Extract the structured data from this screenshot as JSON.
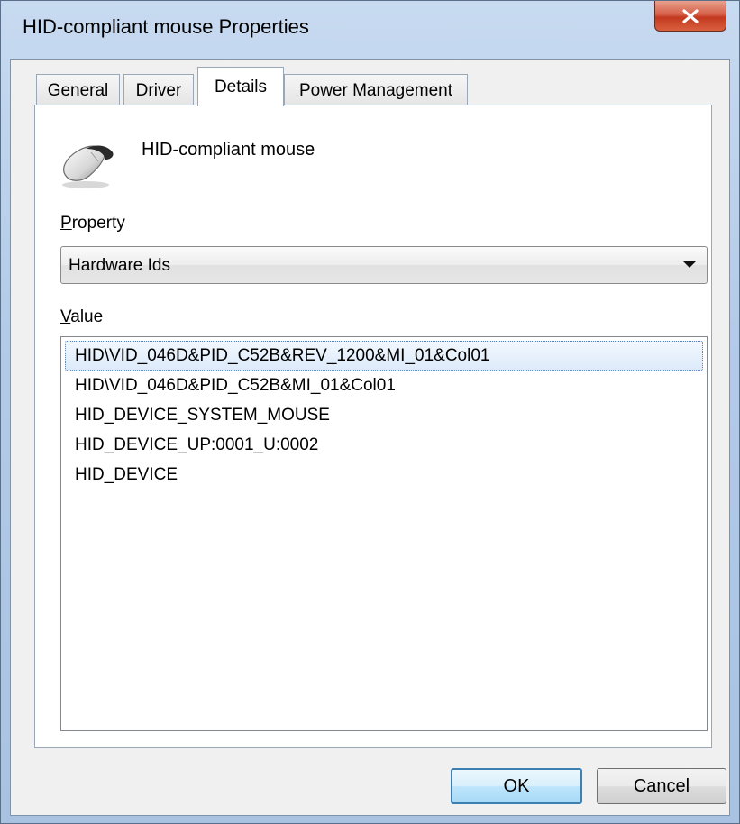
{
  "window": {
    "title": "HID-compliant mouse Properties"
  },
  "tabs": [
    {
      "label": "General",
      "active": false
    },
    {
      "label": "Driver",
      "active": false
    },
    {
      "label": "Details",
      "active": true
    },
    {
      "label": "Power Management",
      "active": false
    }
  ],
  "device": {
    "name": "HID-compliant mouse",
    "icon": "mouse-icon"
  },
  "property": {
    "label_mnemonic": "P",
    "label_rest": "roperty",
    "selected": "Hardware Ids"
  },
  "value": {
    "label_mnemonic": "V",
    "label_rest": "alue",
    "items": [
      "HID\\VID_046D&PID_C52B&REV_1200&MI_01&Col01",
      "HID\\VID_046D&PID_C52B&MI_01&Col01",
      "HID_DEVICE_SYSTEM_MOUSE",
      "HID_DEVICE_UP:0001_U:0002",
      "HID_DEVICE"
    ],
    "selected_index": 0
  },
  "buttons": {
    "ok": "OK",
    "cancel": "Cancel"
  },
  "colors": {
    "titlebar": "#b3cbe8",
    "close_button": "#c2391f",
    "selection": "#ddeafa",
    "default_button_border": "#3c7fb1"
  }
}
